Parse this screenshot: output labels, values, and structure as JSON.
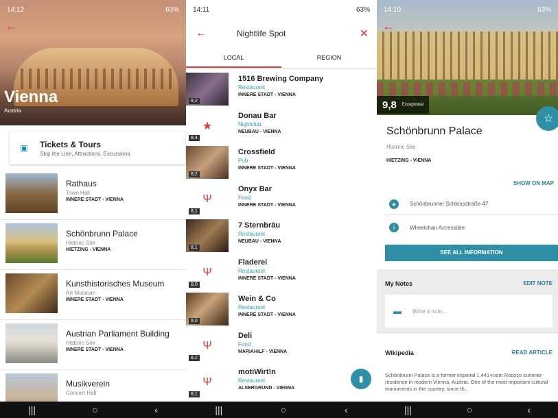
{
  "screen1": {
    "status_time": "14:12",
    "status_right": "63%",
    "title": "Vienna",
    "subtitle": "Austria",
    "tickets": {
      "title": "Tickets & Tours",
      "subtitle": "Skip the Line, Attractions, Excursions"
    },
    "items": [
      {
        "name": "Rathaus",
        "category": "Town Hall",
        "location": "INNERE STADT - VIENNA"
      },
      {
        "name": "Schönbrunn Palace",
        "category": "Historic Site",
        "location": "HIETZING - VIENNA"
      },
      {
        "name": "Kunsthistorisches Museum",
        "category": "Art Museum",
        "location": "INNERE STADT - VIENNA"
      },
      {
        "name": "Austrian Parliament Building",
        "category": "Historic Site",
        "location": "INNERE STADT - VIENNA"
      },
      {
        "name": "Musikverein",
        "category": "Concert Hall",
        "location": ""
      }
    ]
  },
  "screen2": {
    "status_time": "14:11",
    "status_right": "63%",
    "query": "Nightlife Spot",
    "tabs": [
      "LOCAL",
      "REGION"
    ],
    "items": [
      {
        "name": "1516 Brewing Company",
        "category": "Restaurant",
        "location": "INNERE STADT - VIENNA",
        "rating": "9,2",
        "thumb": "photo"
      },
      {
        "name": "Donau Bar",
        "category": "Nightclub",
        "location": "NEUBAU - VIENNA",
        "rating": "8,4",
        "thumb": "star"
      },
      {
        "name": "Crossfield",
        "category": "Pub",
        "location": "INNERE STADT - VIENNA",
        "rating": "8,2",
        "thumb": "photo"
      },
      {
        "name": "Onyx Bar",
        "category": "Food",
        "location": "INNERE STADT - VIENNA",
        "rating": "8,1",
        "thumb": "fork"
      },
      {
        "name": "7 Stern­bräu",
        "category": "Restaurant",
        "location": "NEUBAU - VIENNA",
        "rating": "8,1",
        "thumb": "photo"
      },
      {
        "name": "Fladerei",
        "category": "Restaurant",
        "location": "INNERE STADT - VIENNA",
        "rating": "8,0",
        "thumb": "fork"
      },
      {
        "name": "Wein & Co",
        "category": "Restaurant",
        "location": "INNERE STADT - VIENNA",
        "rating": "8,0",
        "thumb": "photo"
      },
      {
        "name": "Deli",
        "category": "Food",
        "location": "MARIAHILF - VIENNA",
        "rating": "8,2",
        "thumb": "fork"
      },
      {
        "name": "motiWirt!n",
        "category": "Restaurant",
        "location": "ALSERGRUND - VIENNA",
        "rating": "8,1",
        "thumb": "fork"
      }
    ]
  },
  "screen3": {
    "status_time": "14:10",
    "status_right": "63%",
    "score": "9,8",
    "score_label": "Exceptional",
    "name": "Schönbrunn Palace",
    "category": "Historic Site",
    "location": "HIETZING - VIENNA",
    "show_on_map": "SHOW ON MAP",
    "address": "Schönbrunner Schlossstraße 47",
    "accessibility": "Wheelchair Accessible",
    "see_all": "SEE ALL INFORMATION",
    "notes_title": "My Notes",
    "edit_note": "EDIT NOTE",
    "note_placeholder": "Write a note...",
    "wiki_title": "Wikipedia",
    "read_article": "READ ARTICLE",
    "wiki_text": "Schönbrunn Palace is a former imperial 1,441-room Rococo summer residence in modern Vienna, Austria. One of the most important cultural monuments in the country, since th..."
  },
  "colors": {
    "accent_red": "#e53935",
    "accent_teal": "#2f8fa6"
  }
}
